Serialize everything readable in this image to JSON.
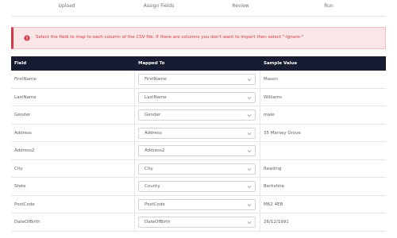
{
  "steps": [
    "Upload",
    "Assign Fields",
    "Review",
    "Run"
  ],
  "alert": {
    "text": "Select the field to map to each column of the CSV file. If there are columns you don't want to import then select \"-Ignore-\"",
    "color": "#d33a46"
  },
  "table": {
    "headers": {
      "field": "Field",
      "mapped_to": "Mapped To",
      "sample": "Sample Value"
    },
    "header_bg": "#171c33",
    "rows": [
      {
        "field": "FirstName",
        "mapped": "FirstName",
        "sample": "Mason"
      },
      {
        "field": "LastName",
        "mapped": "LastName",
        "sample": "Williams"
      },
      {
        "field": "Gender",
        "mapped": "Gender",
        "sample": "male"
      },
      {
        "field": "Address",
        "mapped": "Address",
        "sample": "35 Mersey Grove"
      },
      {
        "field": "Address2",
        "mapped": "Address2",
        "sample": ""
      },
      {
        "field": "City",
        "mapped": "City",
        "sample": "Reading"
      },
      {
        "field": "State",
        "mapped": "County",
        "sample": "Berkshire"
      },
      {
        "field": "PostCode",
        "mapped": "PostCode",
        "sample": "M62 4EB"
      },
      {
        "field": "DateOfBirth",
        "mapped": "DateOfBirth",
        "sample": "26/12/1991"
      }
    ]
  }
}
